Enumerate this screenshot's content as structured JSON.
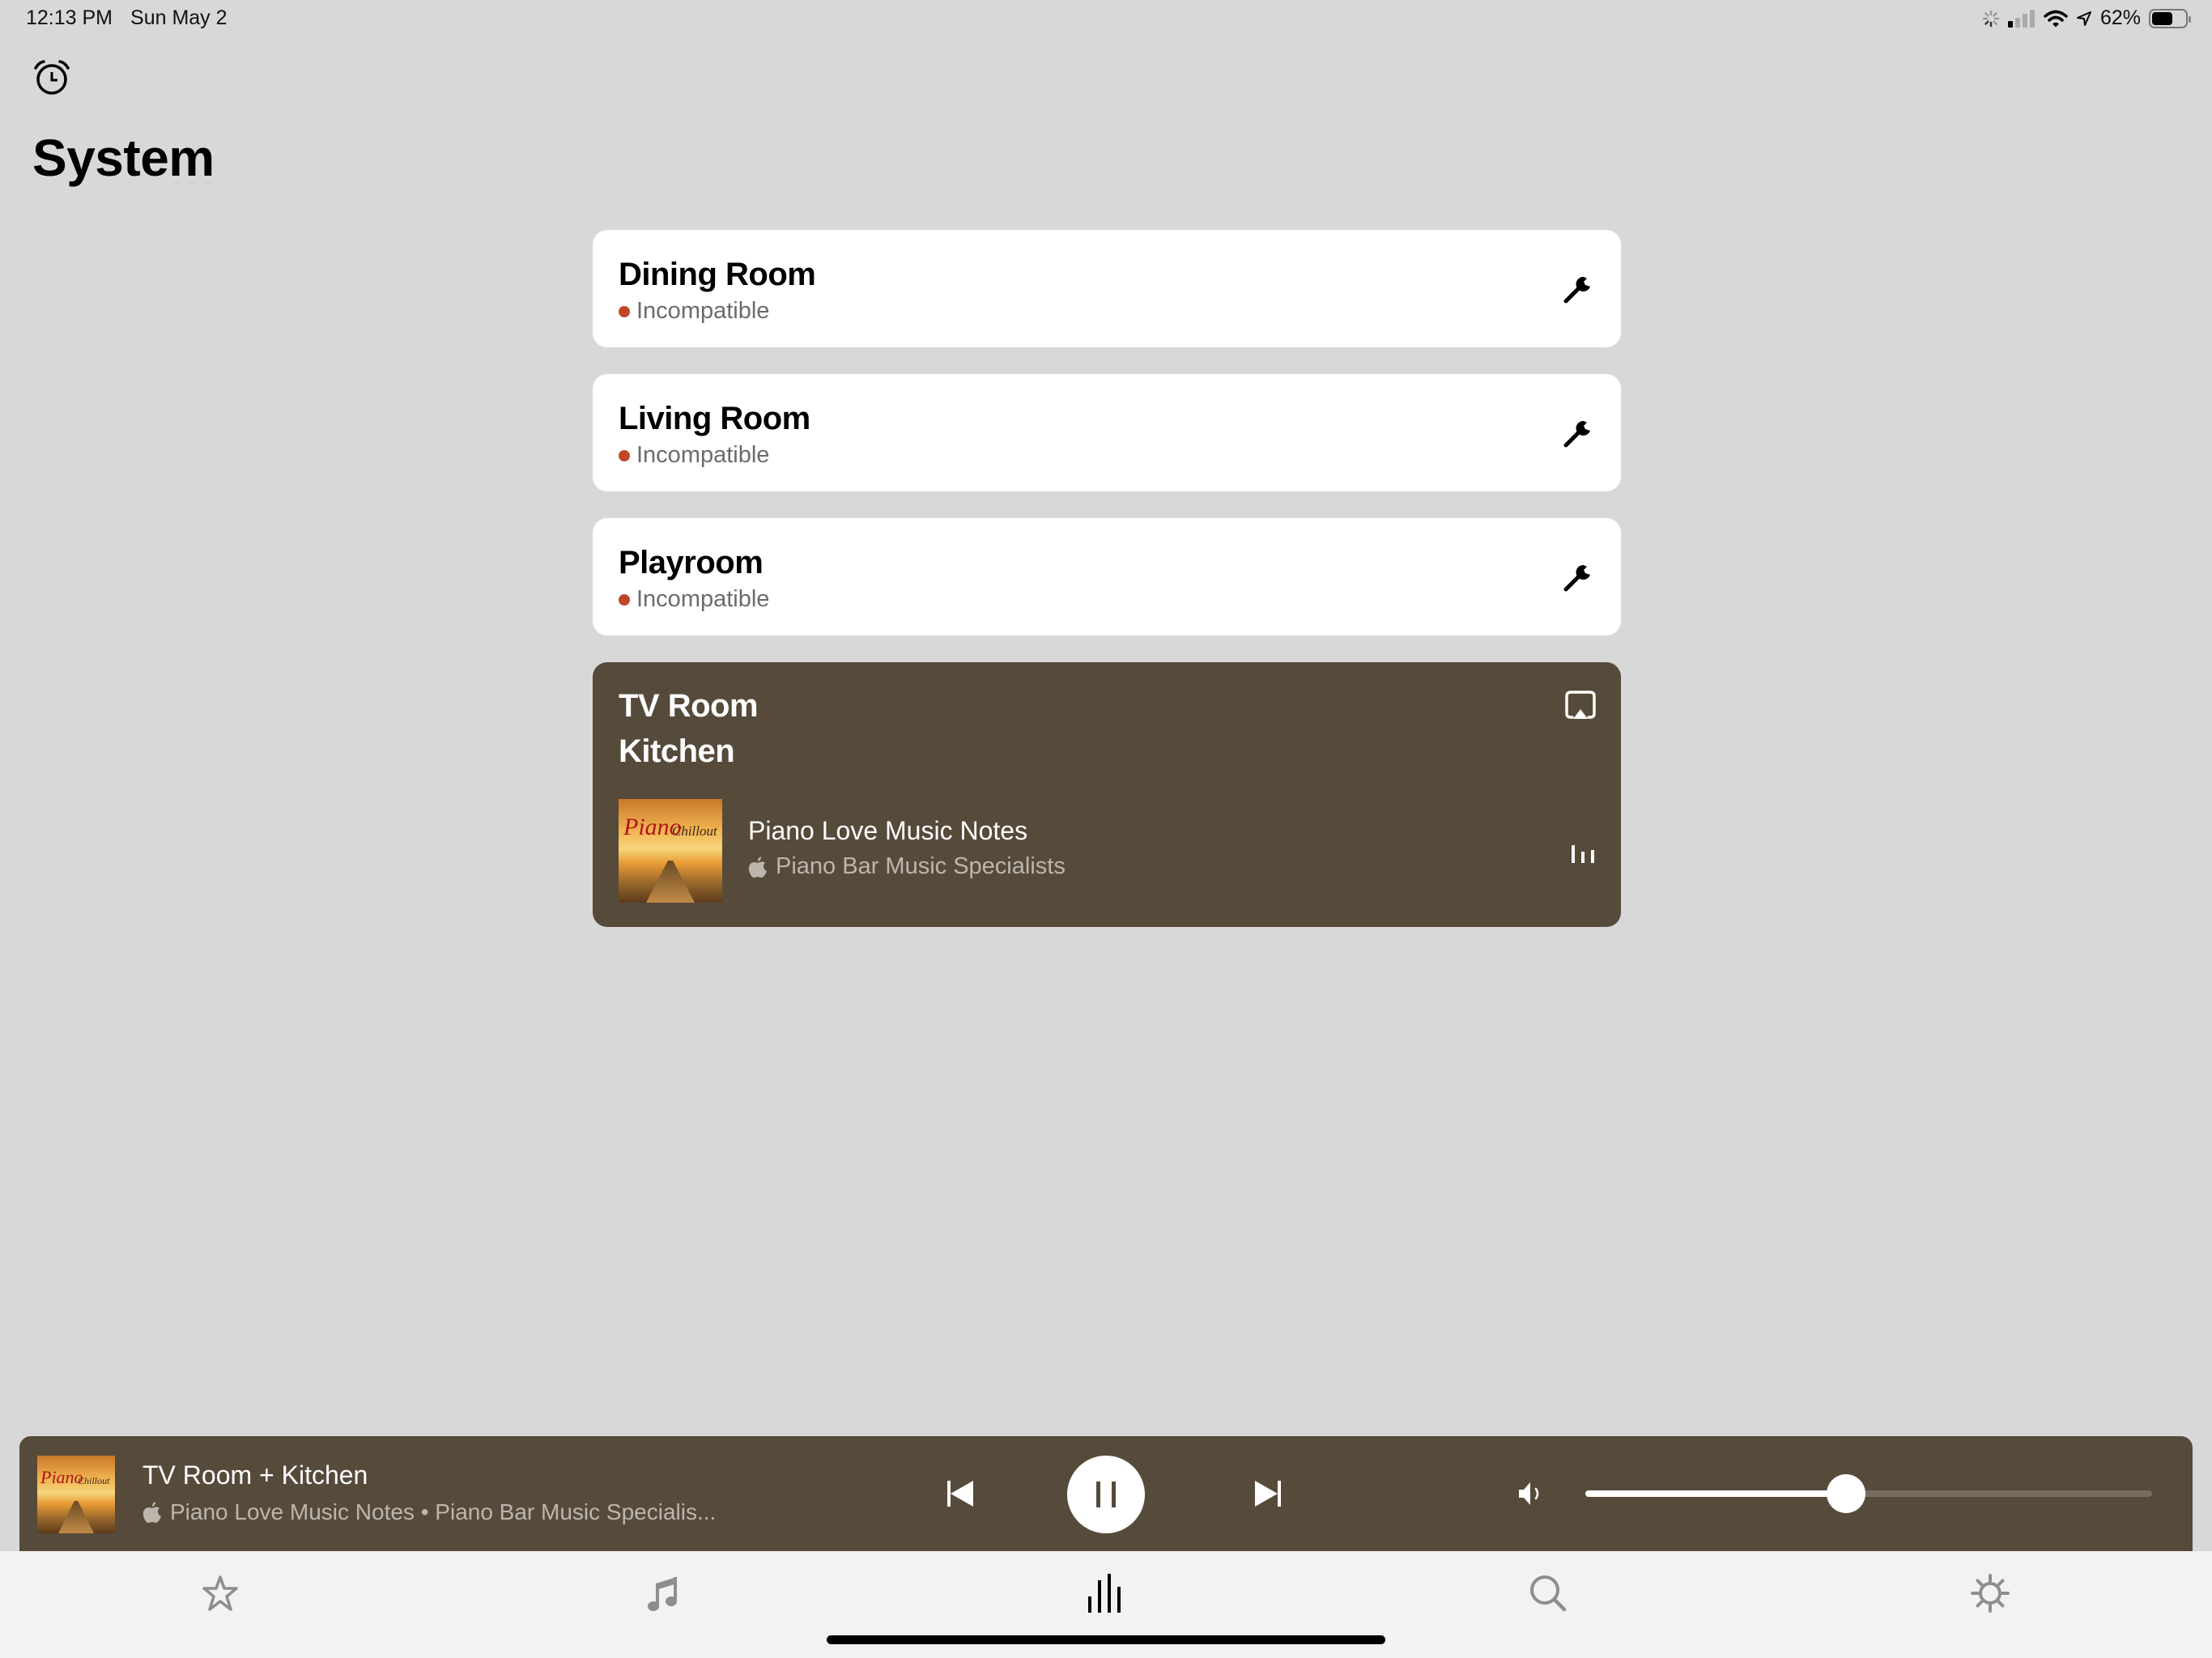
{
  "status_bar": {
    "time": "12:13 PM",
    "date": "Sun May 2",
    "battery_percent": "62%",
    "battery_level": 0.62
  },
  "header": {
    "alarm_icon": "alarm-clock-icon",
    "title": "System"
  },
  "rooms": [
    {
      "name": "Dining Room",
      "status": "Incompatible",
      "action_icon": "wrench-icon"
    },
    {
      "name": "Living Room",
      "status": "Incompatible",
      "action_icon": "wrench-icon"
    },
    {
      "name": "Playroom",
      "status": "Incompatible",
      "action_icon": "wrench-icon"
    }
  ],
  "status_color": "#c0462a",
  "group": {
    "rooms": [
      "TV Room",
      "Kitchen"
    ],
    "action_icon": "airplay-icon",
    "now_playing": {
      "album_art_title": "Piano",
      "album_art_subtitle": "Chillout",
      "track": "Piano Love Music Notes",
      "source_icon": "apple-music-icon",
      "artist": "Piano Bar Music Specialists",
      "playing_indicator": "equalizer-icon"
    },
    "background_color": "#564a3b"
  },
  "mini_player": {
    "title": "TV Room + Kitchen",
    "subtitle": "Piano Love Music Notes • Piano Bar Music Specialis...",
    "album_art_title": "Piano",
    "album_art_subtitle": "Chillout",
    "controls": {
      "previous": "skip-back-icon",
      "play_pause": "pause-icon",
      "next": "skip-forward-icon"
    },
    "volume_icon": "speaker-icon",
    "volume": 0.46
  },
  "tab_bar": {
    "tabs": [
      {
        "id": "favorites",
        "icon": "star-icon",
        "active": false
      },
      {
        "id": "browse",
        "icon": "music-note-icon",
        "active": false
      },
      {
        "id": "system",
        "icon": "rooms-bars-icon",
        "active": true
      },
      {
        "id": "search",
        "icon": "search-icon",
        "active": false
      },
      {
        "id": "settings",
        "icon": "gear-icon",
        "active": false
      }
    ]
  }
}
